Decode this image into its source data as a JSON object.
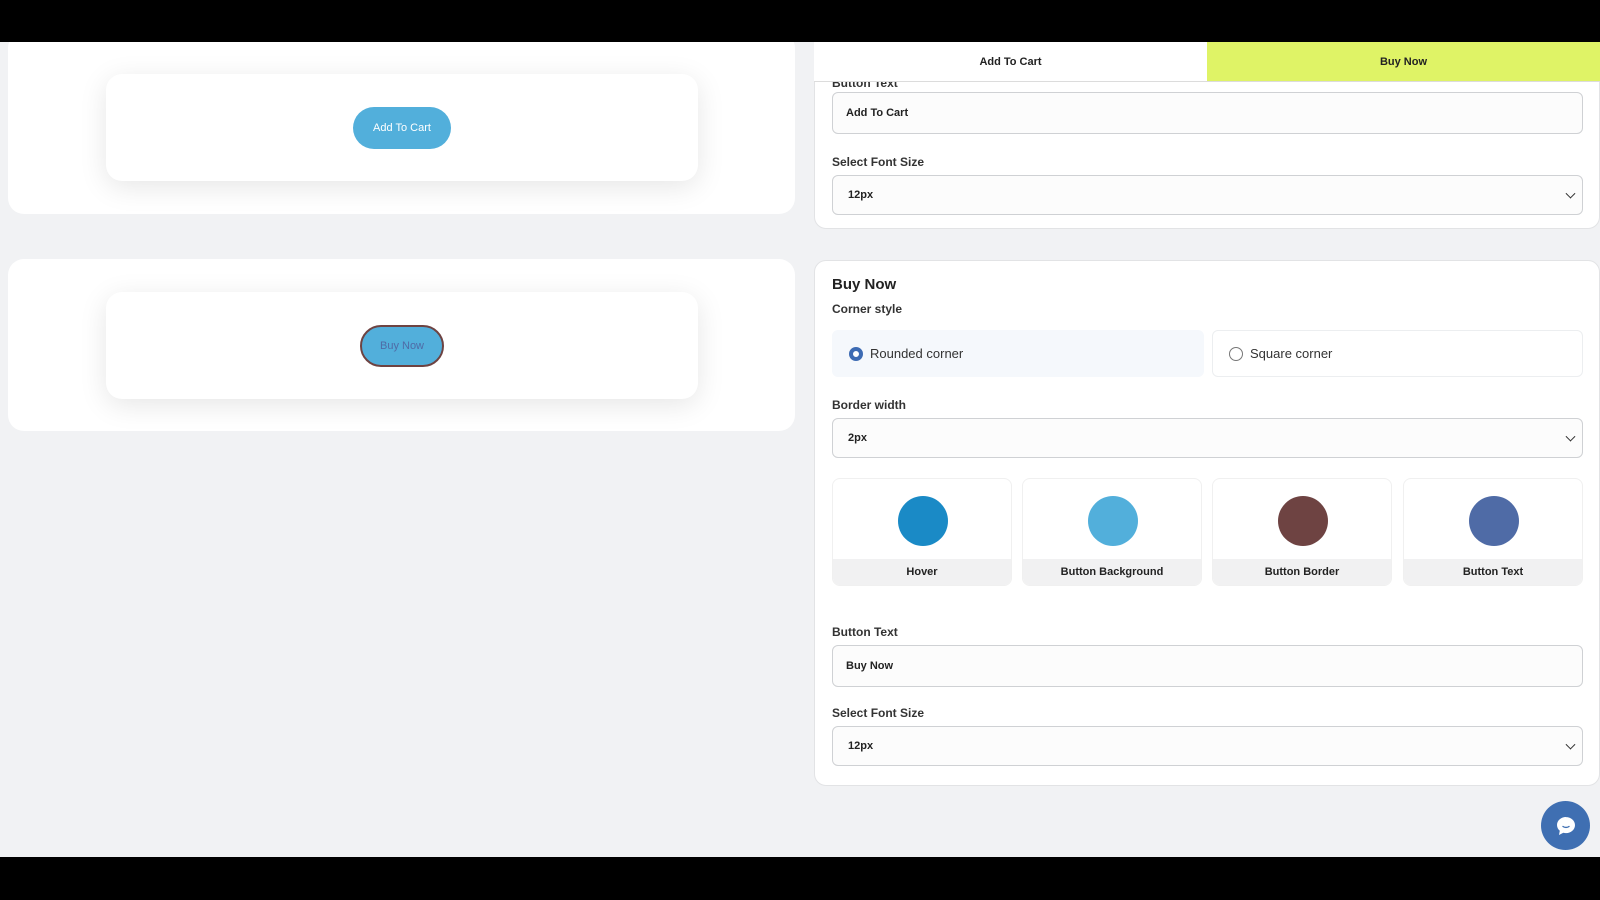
{
  "tabs": [
    {
      "label": "Add To Cart",
      "active": false
    },
    {
      "label": "Buy Now",
      "active": true
    }
  ],
  "preview": {
    "add_to_cart_label": "Add To Cart",
    "buy_now_label": "Buy Now"
  },
  "add_to_cart_settings": {
    "button_text_label": "Button Text",
    "button_text_value": "Add To Cart",
    "font_size_label": "Select Font Size",
    "font_size_value": "12px"
  },
  "buy_now_settings": {
    "title": "Buy Now",
    "corner_style_label": "Corner style",
    "corner_options": [
      {
        "label": "Rounded corner",
        "checked": true
      },
      {
        "label": "Square corner",
        "checked": false
      }
    ],
    "border_width_label": "Border width",
    "border_width_value": "2px",
    "colors": [
      {
        "label": "Hover",
        "color": "#1a8ac6"
      },
      {
        "label": "Button Background",
        "color": "#52afdb"
      },
      {
        "label": "Button Border",
        "color": "#6e4342"
      },
      {
        "label": "Button Text",
        "color": "#4f6ba6"
      }
    ],
    "button_text_label": "Button Text",
    "button_text_value": "Buy Now",
    "font_size_label": "Select Font Size",
    "font_size_value": "12px"
  },
  "chat": {
    "icon": "chat-bubble-icon"
  }
}
